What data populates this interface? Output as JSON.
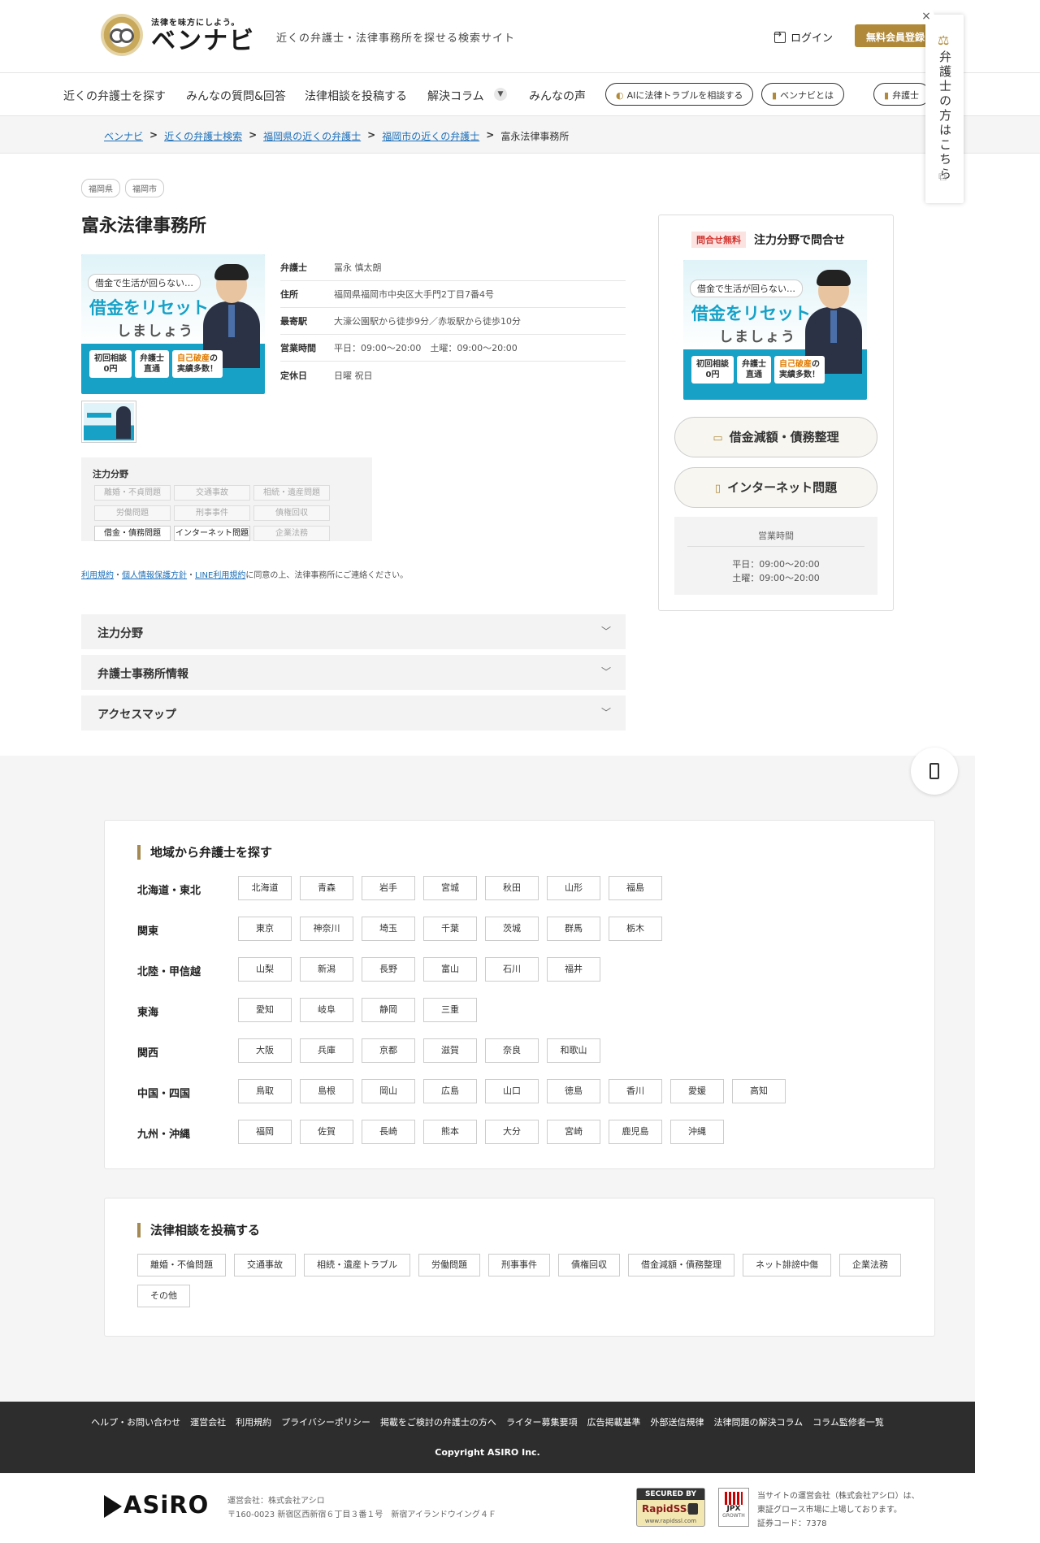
{
  "header": {
    "logo_tagline": "法律を味方にしよう。",
    "logo_name": "ベンナビ",
    "description": "近くの弁護士・法律事務所を探せる検索サイト",
    "login_label": "ログイン",
    "register_label": "無料会員登録"
  },
  "nav": {
    "items": [
      "近くの弁護士を探す",
      "みんなの質問&回答",
      "法律相談を投稿する",
      "解決コラム",
      "みんなの声"
    ],
    "pills": [
      "AIに法律トラブルを相談する",
      "ベンナビとは",
      "弁護士"
    ]
  },
  "side_tab": {
    "close": "×",
    "label": "弁護士の方はこちら"
  },
  "breadcrumb": {
    "links": [
      "ベンナビ",
      "近くの弁護士検索",
      "福岡県の近くの弁護士",
      "福岡市の近くの弁護士"
    ],
    "current": "富永法律事務所",
    "sep": ">"
  },
  "office": {
    "tags": [
      "福岡県",
      "福岡市"
    ],
    "name": "富永法律事務所",
    "info": [
      {
        "label": "弁護士",
        "value": "冨永 慎太朗"
      },
      {
        "label": "住所",
        "value": "福岡県福岡市中央区大手門2丁目7番4号"
      },
      {
        "label": "最寄駅",
        "value": "大濠公園駅から徒歩9分／赤坂駅から徒歩10分"
      },
      {
        "label": "営業時間",
        "value": "平日：09:00〜20:00　土曜：09:00〜20:00"
      },
      {
        "label": "定休日",
        "value": "日曜 祝日"
      }
    ],
    "banner": {
      "speech": "借金で生活が回らない…",
      "main": "借金をリセット",
      "sub": "しましょう",
      "box1": "初回相談\n0円",
      "box2": "弁護士\n直通",
      "box3_hl": "自己破産",
      "box3": "の\n実績多数！"
    },
    "practice": {
      "title": "注力分野",
      "items": [
        {
          "label": "離婚・不貞問題",
          "active": false
        },
        {
          "label": "交通事故",
          "active": false
        },
        {
          "label": "相続・遺産問題",
          "active": false
        },
        {
          "label": "労働問題",
          "active": false
        },
        {
          "label": "刑事事件",
          "active": false
        },
        {
          "label": "債権回収",
          "active": false
        },
        {
          "label": "借金・債務問題",
          "active": true
        },
        {
          "label": "インターネット問題",
          "active": true
        },
        {
          "label": "企業法務",
          "active": false
        }
      ]
    },
    "terms": {
      "link1": "利用規約",
      "sep": "・",
      "link2": "個人情報保護方針",
      "link3": "LINE利用規約",
      "rest": "に同意の上、法律事務所にご連絡ください。"
    },
    "accordions": [
      "注力分野",
      "弁護士事務所情報",
      "アクセスマップ"
    ]
  },
  "contact_card": {
    "badge": "問合せ無料",
    "title": "注力分野で問合せ",
    "buttons": [
      "借金減額・債務整理",
      "インターネット問題"
    ],
    "hours_title": "営業時間",
    "hours": [
      "平日：09:00〜20:00",
      "土曜：09:00〜20:00"
    ]
  },
  "region_search": {
    "title": "地域から弁護士を探す",
    "regions": [
      {
        "name": "北海道・東北",
        "prefs": [
          "北海道",
          "青森",
          "岩手",
          "宮城",
          "秋田",
          "山形",
          "福島"
        ]
      },
      {
        "name": "関東",
        "prefs": [
          "東京",
          "神奈川",
          "埼玉",
          "千葉",
          "茨城",
          "群馬",
          "栃木"
        ]
      },
      {
        "name": "北陸・甲信越",
        "prefs": [
          "山梨",
          "新潟",
          "長野",
          "富山",
          "石川",
          "福井"
        ]
      },
      {
        "name": "東海",
        "prefs": [
          "愛知",
          "岐阜",
          "静岡",
          "三重"
        ]
      },
      {
        "name": "関西",
        "prefs": [
          "大阪",
          "兵庫",
          "京都",
          "滋賀",
          "奈良",
          "和歌山"
        ]
      },
      {
        "name": "中国・四国",
        "prefs": [
          "鳥取",
          "島根",
          "岡山",
          "広島",
          "山口",
          "徳島",
          "香川",
          "愛媛",
          "高知"
        ]
      },
      {
        "name": "九州・沖縄",
        "prefs": [
          "福岡",
          "佐賀",
          "長崎",
          "熊本",
          "大分",
          "宮崎",
          "鹿児島",
          "沖縄"
        ]
      }
    ]
  },
  "consult_post": {
    "title": "法律相談を投稿する",
    "categories": [
      "離婚・不倫問題",
      "交通事故",
      "相続・遺産トラブル",
      "労働問題",
      "刑事事件",
      "債権回収",
      "借金減額・債務整理",
      "ネット誹謗中傷",
      "企業法務",
      "その他"
    ]
  },
  "footer": {
    "links": [
      "ヘルプ・お問い合わせ",
      "運営会社",
      "利用規約",
      "プライバシーポリシー",
      "掲載をご検討の弁護士の方へ",
      "ライター募集要項",
      "広告掲載基準",
      "外部送信規律",
      "法律問題の解決コラム",
      "コラム監修者一覧"
    ],
    "copyright": "Copyright  ASIRO Inc.",
    "asiro_logo": "ASiRO",
    "company_line1": "運営会社：株式会社アシロ",
    "company_line2": "〒160-0023 新宿区西新宿６丁目３番１号　新宿アイランドウイング４Ｆ",
    "ssl_top": "SECURED BY",
    "ssl_name": "RapidSSL",
    "ssl_url": "www.rapidssl.com",
    "jpx_label": "JPX",
    "jpx_sub": "GROWTH",
    "listing_line1": "当サイトの運営会社（株式会社アシロ）は、",
    "listing_line2": "東証グロース市場に上場しております。",
    "listing_line3": "証券コード：7378"
  }
}
